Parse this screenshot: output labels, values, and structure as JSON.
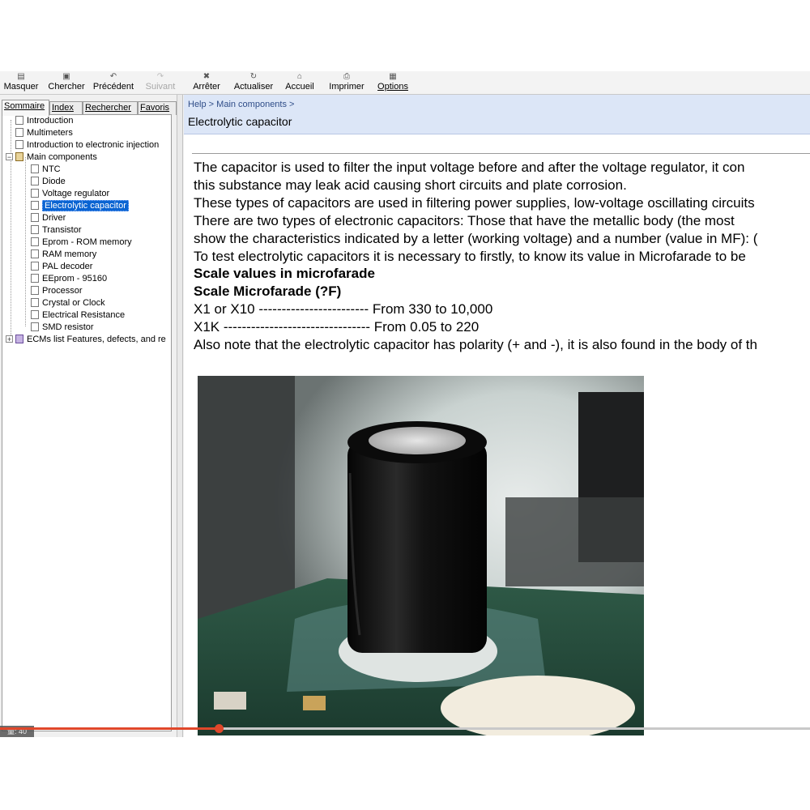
{
  "toolbar": {
    "buttons": [
      {
        "label": "Masquer",
        "icon": "hide-pane-icon"
      },
      {
        "label": "Chercher",
        "icon": "locate-icon"
      },
      {
        "label": "Précédent",
        "icon": "back-arrow-icon"
      },
      {
        "label": "Suivant",
        "icon": "forward-arrow-icon",
        "disabled": true
      },
      {
        "label": "Arrêter",
        "icon": "stop-icon"
      },
      {
        "label": "Actualiser",
        "icon": "refresh-icon"
      },
      {
        "label": "Accueil",
        "icon": "home-icon"
      },
      {
        "label": "Imprimer",
        "icon": "printer-icon"
      },
      {
        "label": "Options",
        "icon": "options-icon"
      }
    ]
  },
  "nav_tabs": [
    {
      "label": "Sommaire",
      "active": true
    },
    {
      "label": "Index"
    },
    {
      "label": "Rechercher"
    },
    {
      "label": "Favoris"
    }
  ],
  "tree": [
    {
      "label": "Introduction",
      "icon": "page-icon"
    },
    {
      "label": "Multimeters",
      "icon": "page-icon"
    },
    {
      "label": "Introduction to electronic injection",
      "icon": "page-icon"
    },
    {
      "label": "Main components",
      "icon": "open-book-icon",
      "expanded": true
    },
    {
      "label": "NTC",
      "icon": "page-icon"
    },
    {
      "label": "Diode",
      "icon": "page-icon"
    },
    {
      "label": "Voltage regulator",
      "icon": "page-icon"
    },
    {
      "label": "Electrolytic capacitor",
      "icon": "page-icon",
      "selected": true
    },
    {
      "label": "Driver",
      "icon": "page-icon"
    },
    {
      "label": "Transistor",
      "icon": "page-icon"
    },
    {
      "label": "Eprom - ROM memory",
      "icon": "page-icon"
    },
    {
      "label": "RAM memory",
      "icon": "page-icon"
    },
    {
      "label": "PAL decoder",
      "icon": "page-icon"
    },
    {
      "label": "EEprom - 95160",
      "icon": "page-icon"
    },
    {
      "label": "Processor",
      "icon": "page-icon"
    },
    {
      "label": "Crystal or Clock",
      "icon": "page-icon"
    },
    {
      "label": "Electrical Resistance",
      "icon": "page-icon"
    },
    {
      "label": "SMD resistor",
      "icon": "page-icon"
    },
    {
      "label": "ECMs list Features, defects, and re",
      "icon": "closed-book-icon",
      "expanded": false
    }
  ],
  "zoom_badge": "量: 40",
  "topic": {
    "breadcrumb": "Help > Main components >",
    "title": "Electrolytic capacitor"
  },
  "article": [
    {
      "text": "The capacitor is used to filter the input voltage before and after the voltage regulator, it con",
      "bold": false
    },
    {
      "text": "this substance may leak acid causing short circuits and plate corrosion.",
      "bold": false
    },
    {
      "text": "These types of capacitors are used in filtering power supplies, low-voltage oscillating circuits",
      "bold": false
    },
    {
      "text": "There are two types of electronic capacitors: Those that have the metallic body (the most",
      "bold": false
    },
    {
      "text": "show the characteristics indicated by a letter (working voltage) and a number (value in MF): (",
      "bold": false
    },
    {
      "text": "To test electrolytic capacitors it is necessary to firstly, to know its value in Microfarade to be",
      "bold": false
    },
    {
      "text": "Scale values in microfarade",
      "bold": true
    },
    {
      "text": "Scale Microfarade (?F)",
      "bold": true
    },
    {
      "text": "X1 or X10 ------------------------ From 330 to 10,000",
      "bold": false
    },
    {
      "text": "X1K -------------------------------- From 0.05 to 220",
      "bold": false
    },
    {
      "text": "Also note that the electrolytic capacitor has polarity (+ and -), it is also found in the body of th",
      "bold": false
    }
  ],
  "video_progress": 0.27,
  "colors": {
    "selection": "#0a64d2",
    "header_band": "#dce6f7",
    "progress": "#e0472a"
  }
}
